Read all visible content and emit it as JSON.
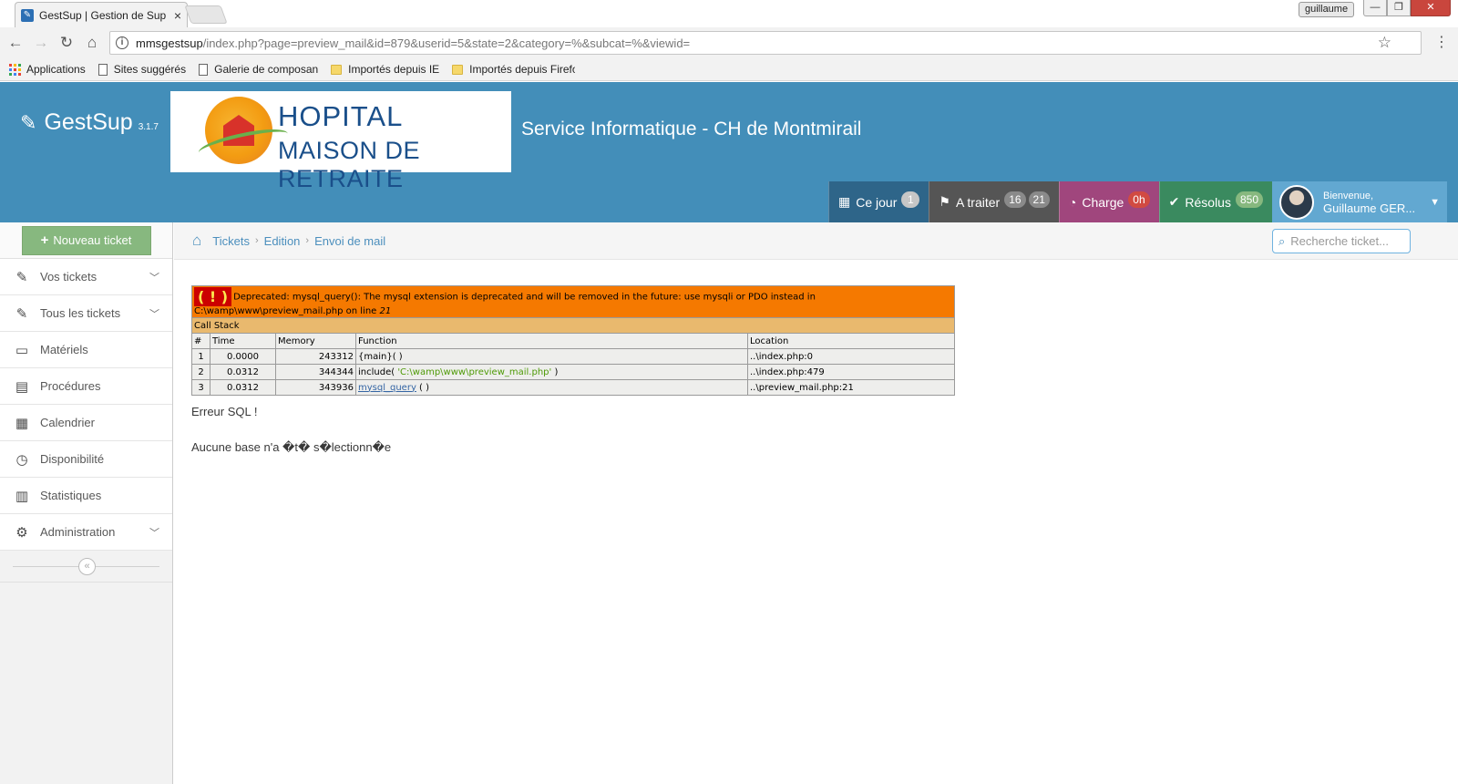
{
  "browser": {
    "tab_title": "GestSup | Gestion de Sup",
    "tab_close": "×",
    "user_label": "guillaume",
    "win_min": "—",
    "win_max": "❐",
    "win_close": "✕",
    "back": "←",
    "forward": "→",
    "reload": "↻",
    "home": "⌂",
    "url_host": "mmsgestsup",
    "url_path": "/index.php?page=preview_mail&id=879&userid=5&state=2&category=%&subcat=%&viewid=",
    "star": "☆",
    "menu": "⋮",
    "bookmarks": [
      {
        "label": "Applications",
        "icon": "apps-icon"
      },
      {
        "label": "Sites suggérés",
        "icon": "page-icon"
      },
      {
        "label": "Galerie de composant",
        "icon": "page-icon"
      },
      {
        "label": "Importés depuis IE",
        "icon": "folder-icon"
      },
      {
        "label": "Importés depuis Firefo",
        "icon": "folder-icon"
      }
    ]
  },
  "header": {
    "brand_icon": "✎",
    "brand_name": "GestSup",
    "version": "3.1.7",
    "logo_line1": "HOPITAL",
    "logo_line2": "MAISON DE RETRAITE",
    "company": "Service Informatique - CH de Montmirail",
    "stats": {
      "today": {
        "label": "Ce jour",
        "badge": "1",
        "icon": "calendar-icon"
      },
      "todo": {
        "label": "A traiter",
        "badge1": "16",
        "badge2": "21",
        "icon": "flag-icon"
      },
      "charge": {
        "label": "Charge",
        "badge": "0h",
        "icon": "tachometer-icon"
      },
      "resolved": {
        "label": "Résolus",
        "badge": "850",
        "icon": "check-circle-icon"
      }
    },
    "user": {
      "welcome": "Bienvenue,",
      "name": "Guillaume GER..."
    }
  },
  "sidebar": {
    "new_ticket": "Nouveau ticket",
    "items": [
      {
        "label": "Vos tickets",
        "icon": "ticket-icon",
        "expandable": true
      },
      {
        "label": "Tous les tickets",
        "icon": "ticket-icon",
        "expandable": true
      },
      {
        "label": "Matériels",
        "icon": "desktop-icon",
        "expandable": false
      },
      {
        "label": "Procédures",
        "icon": "book-icon",
        "expandable": false
      },
      {
        "label": "Calendrier",
        "icon": "calendar-icon",
        "expandable": false
      },
      {
        "label": "Disponibilité",
        "icon": "clock-icon",
        "expandable": false
      },
      {
        "label": "Statistiques",
        "icon": "bar-chart-icon",
        "expandable": false
      },
      {
        "label": "Administration",
        "icon": "cogs-icon",
        "expandable": true
      }
    ],
    "collapse": "«"
  },
  "breadcrumb": {
    "items": [
      "Tickets",
      "Edition",
      "Envoi de mail"
    ],
    "sep": "›",
    "search_placeholder": "Recherche ticket..."
  },
  "xdebug": {
    "warn_icon": "( ! )",
    "message": "Deprecated: mysql_query(): The mysql extension is deprecated and will be removed in the future: use mysqli or PDO instead in C:\\wamp\\www\\preview_mail.php on line ",
    "line": "21",
    "call_stack": "Call Stack",
    "columns": [
      "#",
      "Time",
      "Memory",
      "Function",
      "Location"
    ],
    "rows": [
      {
        "n": "1",
        "time": "0.0000",
        "memory": "243312",
        "func": "{main}( )",
        "func_arg": "",
        "func_end": "",
        "location": "..\\index.php:0"
      },
      {
        "n": "2",
        "time": "0.0312",
        "memory": "344344",
        "func": "include( ",
        "func_arg": "'C:\\wamp\\www\\preview_mail.php'",
        "func_end": " )",
        "location": "..\\index.php:479"
      },
      {
        "n": "3",
        "time": "0.0312",
        "memory": "343936",
        "func": "",
        "func_link": "mysql_query",
        "func_end": " ( )",
        "location": "..\\preview_mail.php:21"
      }
    ]
  },
  "errors": {
    "title": "Erreur SQL !",
    "message": "Aucune base n'a �t� s�lectionn�e"
  },
  "colors": {
    "header_bg": "#438eb9",
    "sidebar_bg": "#f2f2f2",
    "new_ticket_bg": "#87b87f",
    "xdebug_orange": "#f57900"
  }
}
